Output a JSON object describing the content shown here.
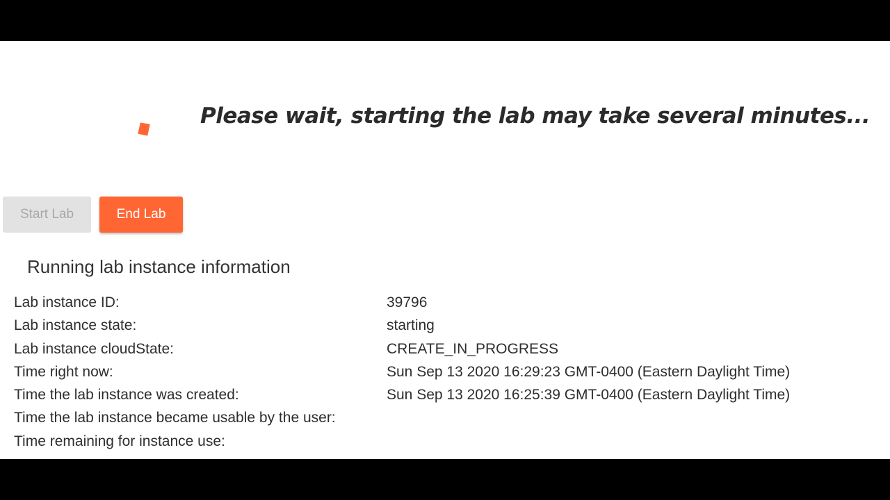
{
  "status": {
    "message": "Please wait, starting the lab may take several minutes..."
  },
  "buttons": {
    "start_label": "Start Lab",
    "end_label": "End Lab"
  },
  "instance_info": {
    "title": "Running lab instance information",
    "rows": [
      {
        "label": "Lab instance ID:",
        "value": "39796"
      },
      {
        "label": "Lab instance state:",
        "value": "starting"
      },
      {
        "label": "Lab instance cloudState:",
        "value": "CREATE_IN_PROGRESS"
      },
      {
        "label": "Time right now:",
        "value": "Sun Sep 13 2020 16:29:23 GMT-0400 (Eastern Daylight Time)"
      },
      {
        "label": "Time the lab instance was created:",
        "value": "Sun Sep 13 2020 16:25:39 GMT-0400 (Eastern Daylight Time)"
      },
      {
        "label": "Time the lab instance became usable by the user:",
        "value": ""
      },
      {
        "label": "Time remaining for instance use:",
        "value": ""
      }
    ]
  },
  "colors": {
    "accent": "#ff6633",
    "disabled_bg": "#e2e2e2",
    "disabled_text": "#a8a8a8",
    "text": "#2e2e2e",
    "letterbox": "#000000"
  },
  "icons": {
    "spinner": "loading-spinner-icon"
  }
}
